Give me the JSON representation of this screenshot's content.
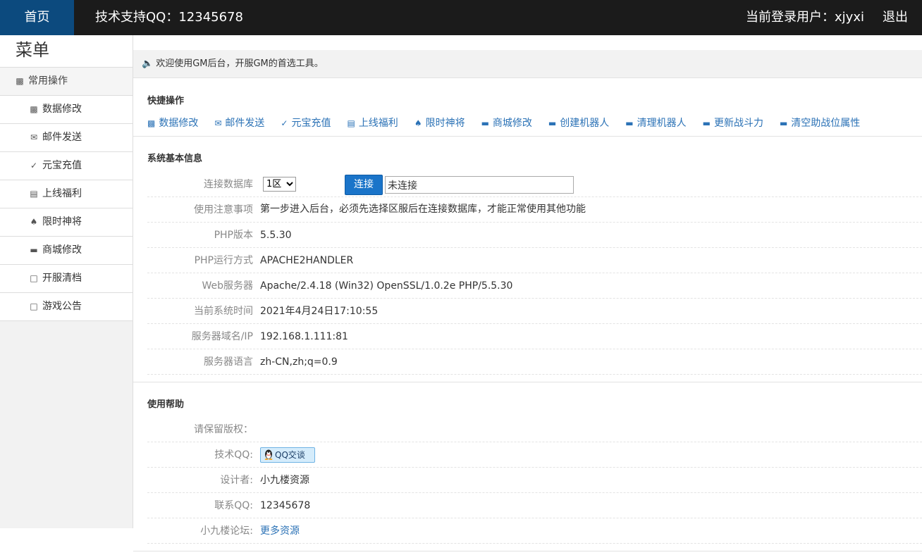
{
  "topbar": {
    "home_label": "首页",
    "support_text": "技术支持QQ：12345678",
    "user_text": "当前登录用户：xjyxi",
    "logout_label": "退出"
  },
  "sidebar": {
    "title": "菜单",
    "group_label": "常用操作",
    "items": [
      {
        "label": "数据修改",
        "icon": "chart-icon"
      },
      {
        "label": "邮件发送",
        "icon": "envelope-icon"
      },
      {
        "label": "元宝充值",
        "icon": "plug-icon"
      },
      {
        "label": "上线福利",
        "icon": "list-icon"
      },
      {
        "label": "限时神将",
        "icon": "spade-icon"
      },
      {
        "label": "商城修改",
        "icon": "folder-icon"
      },
      {
        "label": "开服清档",
        "icon": "file-icon"
      },
      {
        "label": "游戏公告",
        "icon": "file-icon"
      }
    ]
  },
  "welcome": "欢迎使用GM后台，开服GM的首选工具。",
  "shortcuts": {
    "title": "快捷操作",
    "items": [
      {
        "label": "数据修改",
        "icon": "chart-icon"
      },
      {
        "label": "邮件发送",
        "icon": "envelope-icon"
      },
      {
        "label": "元宝充值",
        "icon": "plug-icon"
      },
      {
        "label": "上线福利",
        "icon": "list-icon"
      },
      {
        "label": "限时神将",
        "icon": "spade-icon"
      },
      {
        "label": "商城修改",
        "icon": "folder-icon"
      },
      {
        "label": "创建机器人",
        "icon": "folder-icon"
      },
      {
        "label": "清理机器人",
        "icon": "folder-icon"
      },
      {
        "label": "更新战斗力",
        "icon": "folder-icon"
      },
      {
        "label": "清空助战位属性",
        "icon": "folder-icon"
      }
    ]
  },
  "sysinfo": {
    "title": "系统基本信息",
    "db_label": "连接数据库",
    "db_selected": "1区",
    "connect_label": "连接",
    "status_value": "未连接",
    "rows": [
      {
        "label": "使用注意事项",
        "value": "第一步进入后台，必须先选择区服后在连接数据库，才能正常使用其他功能"
      },
      {
        "label": "PHP版本",
        "value": "5.5.30"
      },
      {
        "label": "PHP运行方式",
        "value": "APACHE2HANDLER"
      },
      {
        "label": "Web服务器",
        "value": "Apache/2.4.18 (Win32) OpenSSL/1.0.2e PHP/5.5.30"
      },
      {
        "label": "当前系统时间",
        "value": "2021年4月24日17:10:55"
      },
      {
        "label": "服务器域名/IP",
        "value": "192.168.1.111:81"
      },
      {
        "label": "服务器语言",
        "value": "zh-CN,zh;q=0.9"
      }
    ]
  },
  "help": {
    "title": "使用帮助",
    "copyright_label": "请保留版权：",
    "tech_qq_label": "技术QQ:",
    "qq_button_label": "QQ交谈",
    "designer_label": "设计者:",
    "designer_value": "小九楼资源",
    "contact_label": "联系QQ:",
    "contact_value": "12345678",
    "forum_label": "小九楼论坛:",
    "forum_link": "更多资源"
  }
}
